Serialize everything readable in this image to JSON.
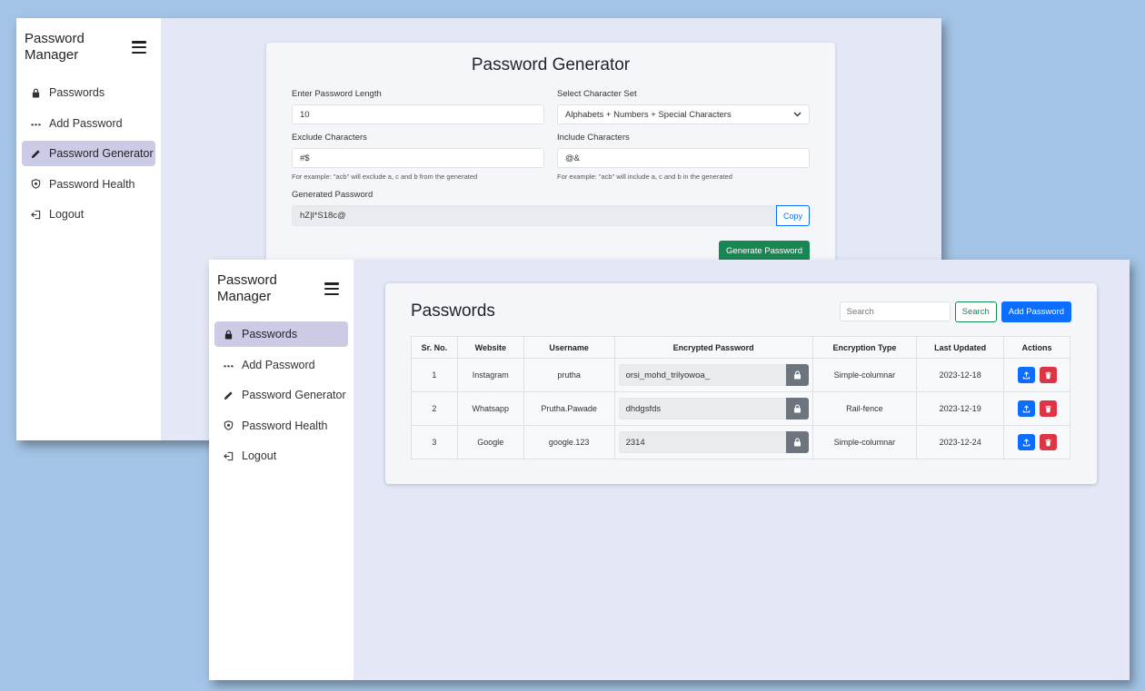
{
  "back_window": {
    "sidebar": {
      "title": "Password Manager",
      "items": [
        {
          "label": "Passwords",
          "icon": "lock-icon",
          "active": false
        },
        {
          "label": "Add Password",
          "icon": "dots-icon",
          "active": false
        },
        {
          "label": "Password Generator",
          "icon": "pencil-icon",
          "active": true
        },
        {
          "label": "Password Health",
          "icon": "shield-icon",
          "active": false
        },
        {
          "label": "Logout",
          "icon": "logout-icon",
          "active": false
        }
      ]
    },
    "generator": {
      "title": "Password Generator",
      "length_label": "Enter Password Length",
      "length_value": "10",
      "charset_label": "Select Character Set",
      "charset_value": "Alphabets + Numbers + Special Characters",
      "exclude_label": "Exclude Characters",
      "exclude_value": "#$",
      "exclude_help": "For example: \"acb\" will exclude a, c and b from the generated",
      "include_label": "Include Characters",
      "include_value": "@&",
      "include_help": "For example: \"acb\" will include a, c and b in the generated",
      "generated_label": "Generated Password",
      "generated_value": "hZ|l*S18c@",
      "copy_label": "Copy",
      "generate_label": "Generate Password"
    }
  },
  "front_window": {
    "sidebar": {
      "title": "Password Manager",
      "items": [
        {
          "label": "Passwords",
          "icon": "lock-icon",
          "active": true
        },
        {
          "label": "Add Password",
          "icon": "dots-icon",
          "active": false
        },
        {
          "label": "Password Generator",
          "icon": "pencil-icon",
          "active": false
        },
        {
          "label": "Password Health",
          "icon": "shield-icon",
          "active": false
        },
        {
          "label": "Logout",
          "icon": "logout-icon",
          "active": false
        }
      ]
    },
    "passwords": {
      "title": "Passwords",
      "search_placeholder": "Search",
      "search_button": "Search",
      "add_button": "Add Password",
      "columns": [
        "Sr. No.",
        "Website",
        "Username",
        "Encrypted Password",
        "Encryption Type",
        "Last Updated",
        "Actions"
      ],
      "rows": [
        {
          "sr": "1",
          "website": "Instagram",
          "username": "prutha",
          "encrypted": "orsi_mohd_trilyowoa_",
          "type": "Simple-columnar",
          "updated": "2023-12-18"
        },
        {
          "sr": "2",
          "website": "Whatsapp",
          "username": "Prutha.Pawade",
          "encrypted": "dhdgsfds",
          "type": "Rail-fence",
          "updated": "2023-12-19"
        },
        {
          "sr": "3",
          "website": "Google",
          "username": "google.123",
          "encrypted": "2314",
          "type": "Simple-columnar",
          "updated": "2023-12-24"
        }
      ]
    }
  },
  "colors": {
    "background": "#a3c4e6",
    "content_bg": "#e3e7f6",
    "active_nav": "#cbcbe6",
    "primary": "#0d6efd",
    "success": "#198754",
    "danger": "#dc3545",
    "secondary": "#6c757d"
  }
}
